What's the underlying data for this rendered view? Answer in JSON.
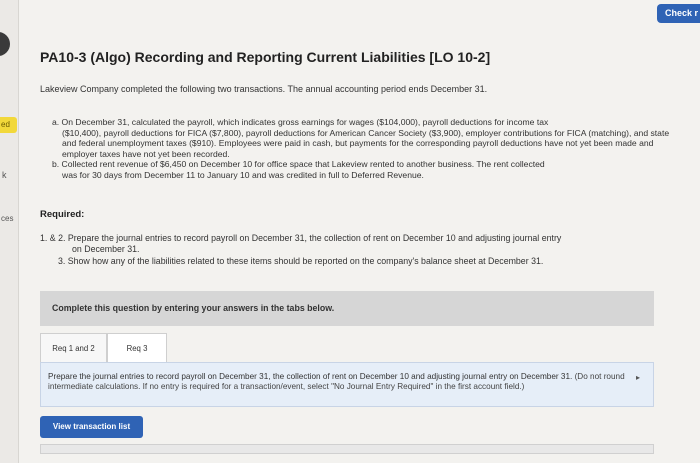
{
  "header": {
    "check_label": "Check r"
  },
  "sidebar": {
    "badge_text": "ed",
    "fragment_k": "k",
    "fragment_ces": "ces"
  },
  "question": {
    "title": "PA10-3 (Algo) Recording and Reporting Current Liabilities [LO 10-2]",
    "intro": "Lakeview Company completed the following two transactions. The annual accounting period ends December 31.",
    "transactions": [
      {
        "line1": "a. On December 31, calculated the payroll, which indicates gross earnings for wages ($104,000), payroll deductions for income tax",
        "rest": "($10,400), payroll deductions for FICA ($7,800), payroll deductions for American Cancer Society ($3,900), employer contributions for FICA (matching), and state and federal unemployment taxes ($910). Employees were paid in cash, but payments for the corresponding payroll deductions have not yet been made and employer taxes have not yet been recorded."
      },
      {
        "line1": "b. Collected rent revenue of $6,450 on December 10 for office space that Lakeview rented to another business. The rent collected",
        "rest": "was for 30 days from December 11 to January 10 and was credited in full to Deferred Revenue."
      }
    ],
    "required_heading": "Required:",
    "required_1_line1": "1. & 2. Prepare the journal entries to record payroll on December 31, the collection of rent on December 10 and adjusting journal entry",
    "required_1_line2": "on December 31.",
    "required_3": "3. Show how any of the liabilities related to these items should be reported on the company's balance sheet at December 31."
  },
  "instructions": {
    "text": "Complete this question by entering your answers in the tabs below."
  },
  "tabs": [
    {
      "label": "Req 1 and 2"
    },
    {
      "label": "Req 3"
    }
  ],
  "prompt": {
    "main": "Prepare the journal entries to record payroll on December 31, the collection of rent on December 10 and adjusting journal entry on December 31.",
    "note": "(Do not round intermediate calculations. If no entry is required for a transaction/event, select \"No Journal Entry Required\" in the first account field.)"
  },
  "buttons": {
    "view_transaction_list": "View transaction list"
  }
}
